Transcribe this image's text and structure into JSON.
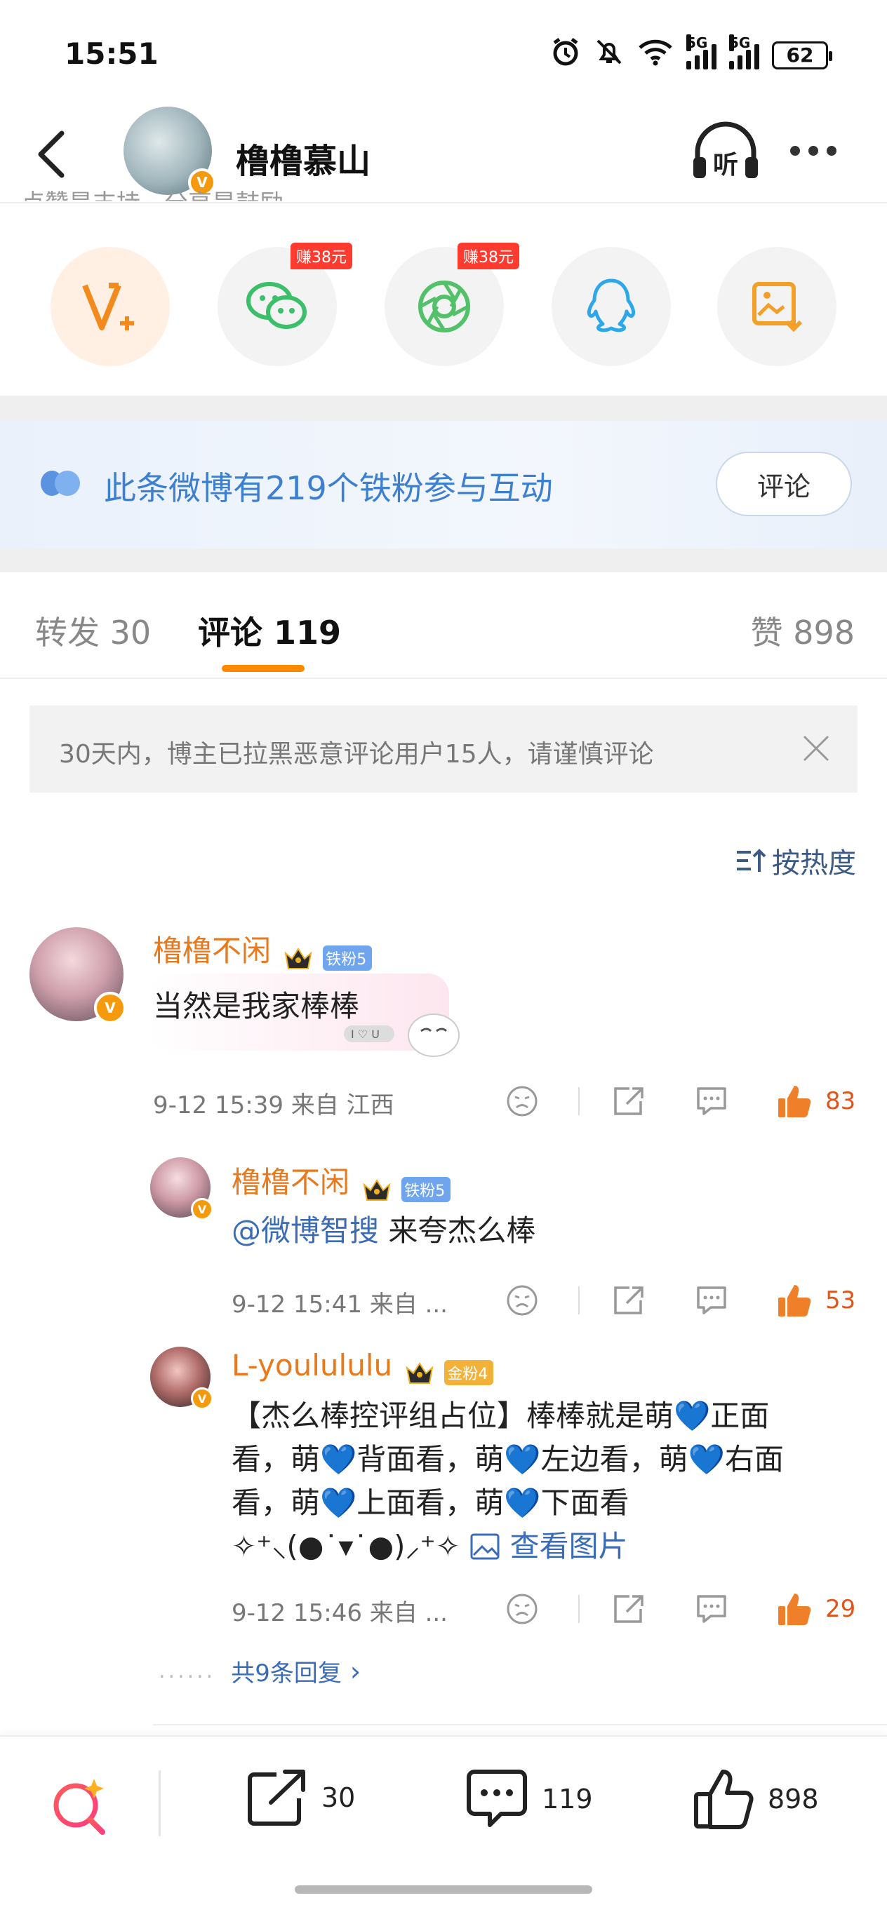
{
  "status_bar": {
    "time": "15:51",
    "signal1_label": "5G",
    "signal2_label": "5G",
    "battery": "62"
  },
  "header": {
    "title": "橹橹慕山",
    "listen_label": "听",
    "avatar_badge": "V"
  },
  "share": {
    "peek_text": "点赞是支持，分享是鼓励",
    "wechat_earn": "赚38元",
    "moments_earn": "赚38元"
  },
  "fans_banner": {
    "text": "此条微博有219个铁粉参与互动",
    "button": "评论"
  },
  "tabs": {
    "repost": "转发 30",
    "comment": "评论 119",
    "like": "赞 898"
  },
  "notice": {
    "text": "30天内，博主已拉黑恶意评论用户15人，请谨慎评论"
  },
  "sort": {
    "label": "按热度"
  },
  "comments": [
    {
      "name": "橹橹不闲",
      "badge": "铁粉5",
      "text": "当然是我家棒棒",
      "deco_label": "I ♡ U",
      "time": "9-12 15:39  来自 江西",
      "likes": "83"
    }
  ],
  "replies": [
    {
      "name": "橹橹不闲",
      "badge": "铁粉5",
      "mention": "@微博智搜",
      "text": " 来夸杰么棒",
      "time": "9-12 15:41  来自 ...",
      "likes": "53"
    },
    {
      "name": "L-youlululu",
      "badge": "金粉4",
      "text": "【杰么棒控评组占位】棒棒就是萌💙正面看，萌💙背面看，萌💙左边看，萌💙右面看，萌💙上面看，萌💙下面看✧⁺⸜(●˙▾˙●)⸝⁺✧",
      "view_image": "查看图片",
      "time": "9-12 15:46  来自 ...",
      "likes": "29"
    }
  ],
  "more_replies": {
    "dots": "......",
    "label": "共9条回复",
    "chevron": "›"
  },
  "bottom_bar": {
    "repost_count": "30",
    "comment_count": "119",
    "like_count": "898"
  },
  "colors": {
    "accent_orange": "#ff8a00",
    "name_orange": "#e8791c",
    "link_blue": "#3b6cb8",
    "fans_blue": "#3d7fd0",
    "like_red": "#e0551c"
  }
}
